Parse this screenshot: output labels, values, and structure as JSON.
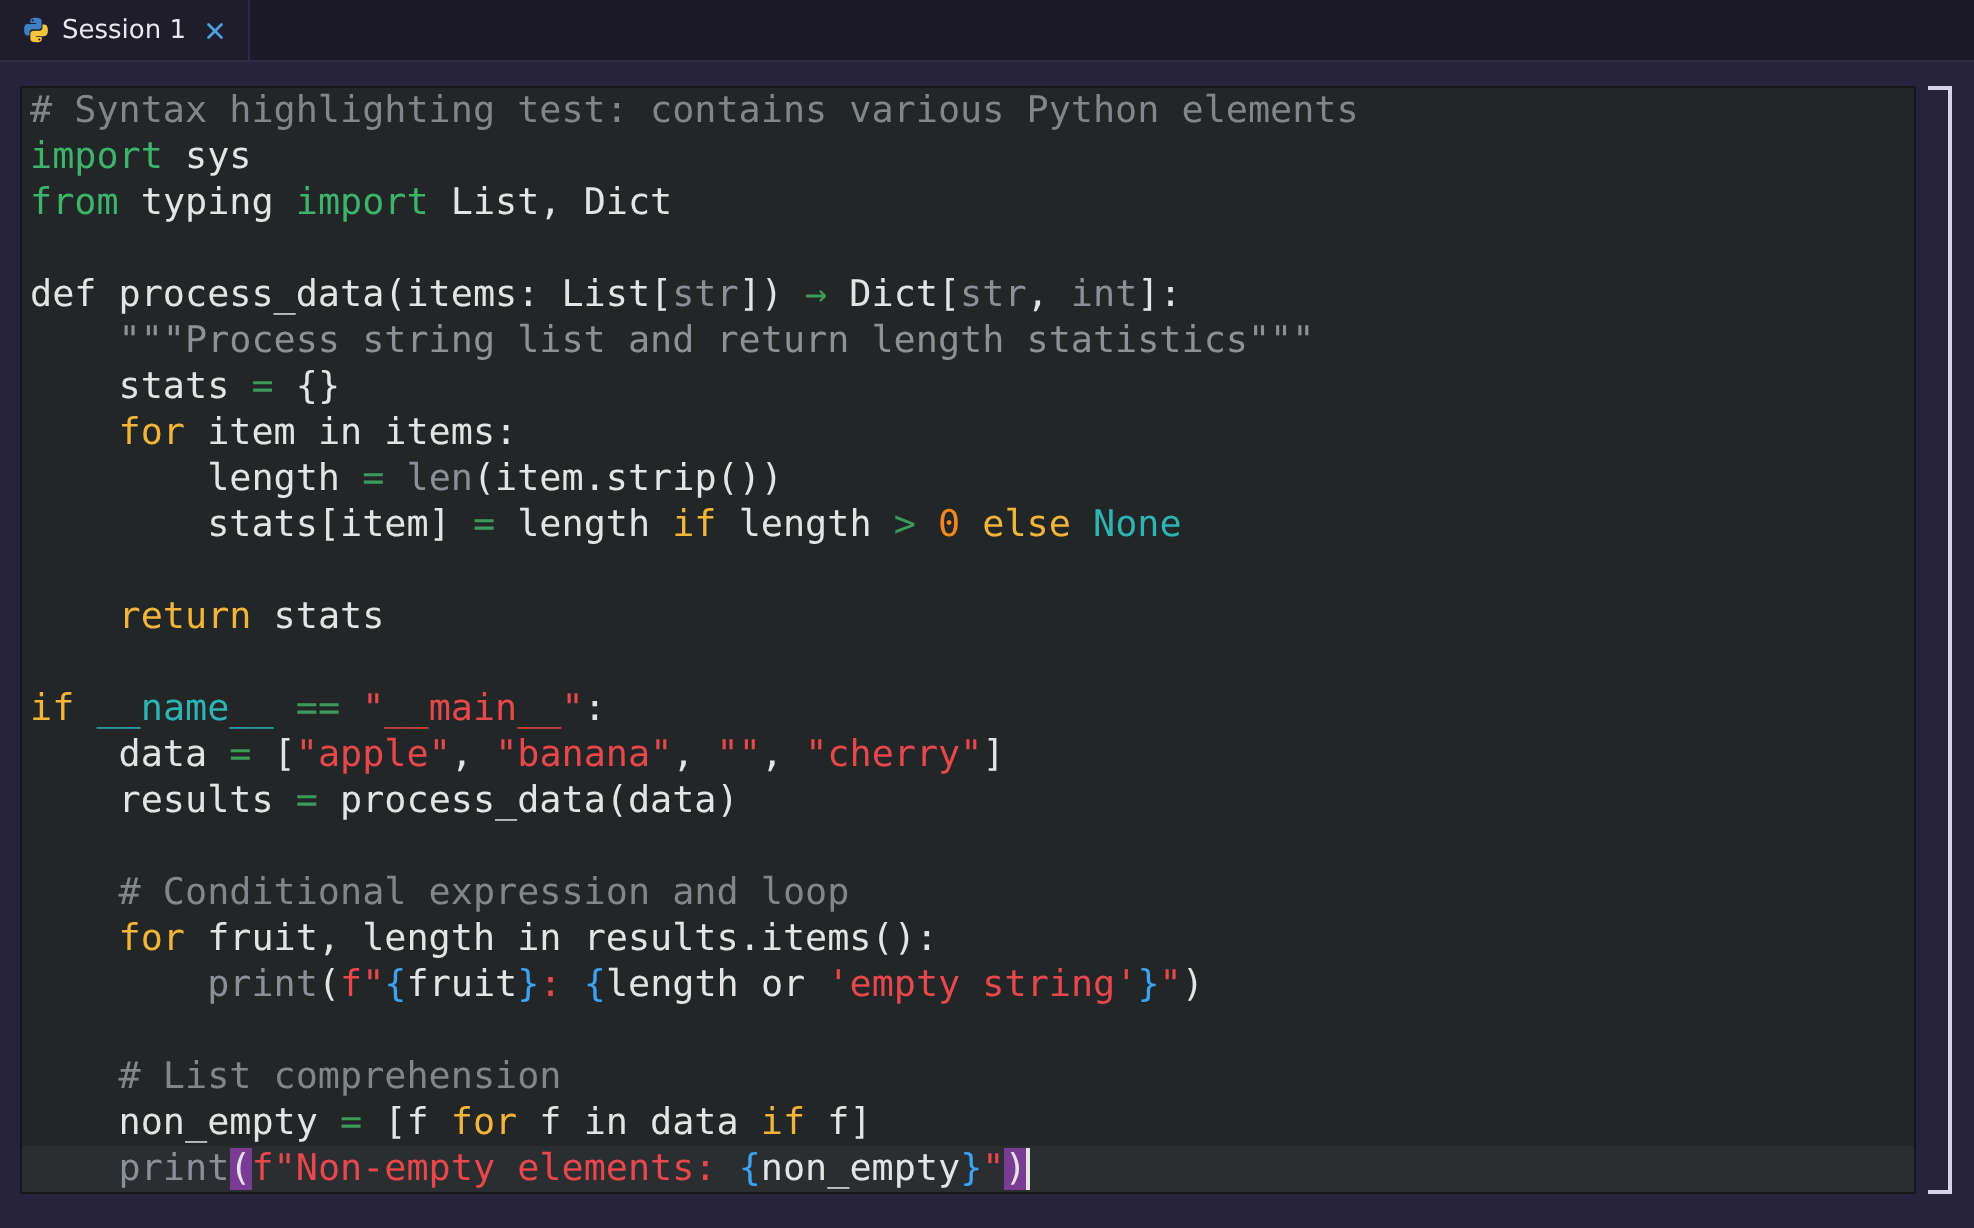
{
  "tabs": [
    {
      "label": "Session 1",
      "selected": true
    }
  ],
  "editor": {
    "lines": [
      {
        "current": false,
        "tokens": [
          {
            "kind": "comment",
            "text": "# Syntax highlighting test: contains various Python elements"
          }
        ]
      },
      {
        "current": false,
        "tokens": [
          {
            "kind": "import",
            "text": "import"
          },
          {
            "kind": "plain",
            "text": " sys"
          }
        ]
      },
      {
        "current": false,
        "tokens": [
          {
            "kind": "import",
            "text": "from"
          },
          {
            "kind": "plain",
            "text": " typing "
          },
          {
            "kind": "import",
            "text": "import"
          },
          {
            "kind": "plain",
            "text": " List, Dict"
          }
        ]
      },
      {
        "current": false
      },
      {
        "current": false,
        "tokens": [
          {
            "kind": "plain",
            "text": "def process_data(items: List["
          },
          {
            "kind": "builtin",
            "text": "str"
          },
          {
            "kind": "plain",
            "text": "]) "
          },
          {
            "kind": "arrow",
            "text": "→"
          },
          {
            "kind": "plain",
            "text": " Dict["
          },
          {
            "kind": "builtin",
            "text": "str"
          },
          {
            "kind": "plain",
            "text": ", "
          },
          {
            "kind": "builtin",
            "text": "int"
          },
          {
            "kind": "plain",
            "text": "]:"
          }
        ]
      },
      {
        "current": false,
        "tokens": [
          {
            "kind": "docstring",
            "text": "    \"\"\"Process string list and return length statistics\"\"\""
          }
        ]
      },
      {
        "current": false,
        "tokens": [
          {
            "kind": "plain",
            "text": "    stats "
          },
          {
            "kind": "operator",
            "text": "="
          },
          {
            "kind": "plain",
            "text": " {}"
          }
        ]
      },
      {
        "current": false,
        "tokens": [
          {
            "kind": "keyword",
            "text": "    for"
          },
          {
            "kind": "plain",
            "text": " item in items:"
          }
        ]
      },
      {
        "current": false,
        "tokens": [
          {
            "kind": "plain",
            "text": "        length "
          },
          {
            "kind": "operator",
            "text": "="
          },
          {
            "kind": "builtin",
            "text": " len"
          },
          {
            "kind": "plain",
            "text": "(item.strip())"
          }
        ]
      },
      {
        "current": false,
        "tokens": [
          {
            "kind": "plain",
            "text": "        stats[item] "
          },
          {
            "kind": "operator",
            "text": "="
          },
          {
            "kind": "plain",
            "text": " length "
          },
          {
            "kind": "keyword",
            "text": "if"
          },
          {
            "kind": "plain",
            "text": " length "
          },
          {
            "kind": "operator",
            "text": ">"
          },
          {
            "kind": "number",
            "text": " 0"
          },
          {
            "kind": "keyword",
            "text": " else"
          },
          {
            "kind": "constant",
            "text": " None"
          }
        ]
      },
      {
        "current": false
      },
      {
        "current": false,
        "tokens": [
          {
            "kind": "keyword",
            "text": "    return"
          },
          {
            "kind": "plain",
            "text": " stats"
          }
        ]
      },
      {
        "current": false
      },
      {
        "current": false,
        "tokens": [
          {
            "kind": "keyword",
            "text": "if"
          },
          {
            "kind": "constant",
            "text": " __name__"
          },
          {
            "kind": "operator",
            "text": " =="
          },
          {
            "kind": "string",
            "text": " \"__main__\""
          },
          {
            "kind": "plain",
            "text": ":"
          }
        ]
      },
      {
        "current": false,
        "tokens": [
          {
            "kind": "plain",
            "text": "    data "
          },
          {
            "kind": "operator",
            "text": "="
          },
          {
            "kind": "plain",
            "text": " ["
          },
          {
            "kind": "string",
            "text": "\"apple\""
          },
          {
            "kind": "plain",
            "text": ", "
          },
          {
            "kind": "string",
            "text": "\"banana\""
          },
          {
            "kind": "plain",
            "text": ", "
          },
          {
            "kind": "string",
            "text": "\"\""
          },
          {
            "kind": "plain",
            "text": ", "
          },
          {
            "kind": "string",
            "text": "\"cherry\""
          },
          {
            "kind": "plain",
            "text": "]"
          }
        ]
      },
      {
        "current": false,
        "tokens": [
          {
            "kind": "plain",
            "text": "    results "
          },
          {
            "kind": "operator",
            "text": "="
          },
          {
            "kind": "plain",
            "text": " process_data(data)"
          }
        ]
      },
      {
        "current": false
      },
      {
        "current": false,
        "tokens": [
          {
            "kind": "comment",
            "text": "    # Conditional expression and loop"
          }
        ]
      },
      {
        "current": false,
        "tokens": [
          {
            "kind": "keyword",
            "text": "    for"
          },
          {
            "kind": "plain",
            "text": " fruit, length in results.items():"
          }
        ]
      },
      {
        "current": false,
        "tokens": [
          {
            "kind": "builtin",
            "text": "        print"
          },
          {
            "kind": "plain",
            "text": "("
          },
          {
            "kind": "string",
            "text": "f\""
          },
          {
            "kind": "brace",
            "text": "{"
          },
          {
            "kind": "plain",
            "text": "fruit"
          },
          {
            "kind": "brace",
            "text": "}"
          },
          {
            "kind": "string",
            "text": ": "
          },
          {
            "kind": "brace",
            "text": "{"
          },
          {
            "kind": "plain",
            "text": "length or "
          },
          {
            "kind": "string",
            "text": "'empty string'"
          },
          {
            "kind": "brace",
            "text": "}"
          },
          {
            "kind": "string",
            "text": "\""
          },
          {
            "kind": "plain",
            "text": ")"
          }
        ]
      },
      {
        "current": false
      },
      {
        "current": false,
        "tokens": [
          {
            "kind": "comment",
            "text": "    # List comprehension"
          }
        ]
      },
      {
        "current": false,
        "tokens": [
          {
            "kind": "plain",
            "text": "    non_empty "
          },
          {
            "kind": "operator",
            "text": "="
          },
          {
            "kind": "plain",
            "text": " [f "
          },
          {
            "kind": "keyword",
            "text": "for"
          },
          {
            "kind": "plain",
            "text": " f in data "
          },
          {
            "kind": "keyword",
            "text": "if"
          },
          {
            "kind": "plain",
            "text": " f]"
          }
        ]
      },
      {
        "current": true,
        "tokens": [
          {
            "kind": "builtin",
            "text": "    print"
          },
          {
            "kind": "match",
            "text": "("
          },
          {
            "kind": "string",
            "text": "f\"Non-empty elements: "
          },
          {
            "kind": "brace",
            "text": "{"
          },
          {
            "kind": "plain",
            "text": "non_empty"
          },
          {
            "kind": "brace",
            "text": "}"
          },
          {
            "kind": "string",
            "text": "\""
          },
          {
            "kind": "match",
            "text": ")"
          }
        ]
      }
    ]
  }
}
